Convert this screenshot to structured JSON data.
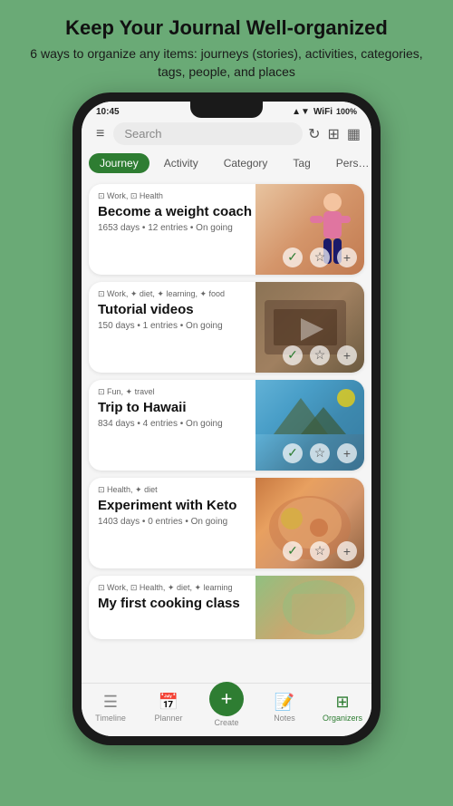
{
  "header": {
    "title": "Keep Your Journal Well-organized",
    "subtitle": "6 ways to organize any items: journeys (stories), activities, categories, tags, people, and places"
  },
  "statusBar": {
    "time": "10:45",
    "battery": "100%",
    "signal": "▲▼"
  },
  "searchBar": {
    "placeholder": "Search",
    "menuIcon": "≡",
    "refreshIcon": "↻",
    "mapIcon": "⊞",
    "calendarIcon": "▦"
  },
  "filterTabs": [
    {
      "label": "Journey",
      "active": true
    },
    {
      "label": "Activity",
      "active": false
    },
    {
      "label": "Category",
      "active": false
    },
    {
      "label": "Tag",
      "active": false
    },
    {
      "label": "Pers…",
      "active": false
    }
  ],
  "journeyCards": [
    {
      "id": "weight-coach",
      "tags": "⊡ Work, ⊡ Health",
      "title": "Become a weight coach",
      "meta": "1653 days • 12 entries • On going",
      "bgClass": "card-bg-fitness"
    },
    {
      "id": "tutorial-videos",
      "tags": "⊡ Work, ✦ diet, ✦ learning, ✦ food",
      "title": "Tutorial videos",
      "meta": "150 days • 1 entries • On going",
      "bgClass": "card-bg-tutorial"
    },
    {
      "id": "hawaii",
      "tags": "⊡ Fun, ✦ travel",
      "title": "Trip to Hawaii",
      "meta": "834 days • 4 entries • On going",
      "bgClass": "card-bg-hawaii"
    },
    {
      "id": "keto",
      "tags": "⊡ Health, ✦ diet",
      "title": "Experiment with Keto",
      "meta": "1403 days • 0 entries • On going",
      "bgClass": "card-bg-keto"
    },
    {
      "id": "cooking-class",
      "tags": "⊡ Work, ⊡ Health, ✦ diet, ✦ learning",
      "title": "My first cooking class",
      "meta": "",
      "bgClass": "card-bg-cooking"
    }
  ],
  "bottomNav": [
    {
      "icon": "☰",
      "label": "Timeline",
      "active": false
    },
    {
      "icon": "📅",
      "label": "Planner",
      "active": false
    },
    {
      "icon": "+",
      "label": "Create",
      "active": false,
      "isCreate": true
    },
    {
      "icon": "📝",
      "label": "Notes",
      "active": false
    },
    {
      "icon": "⊞",
      "label": "Organizers",
      "active": true
    }
  ]
}
